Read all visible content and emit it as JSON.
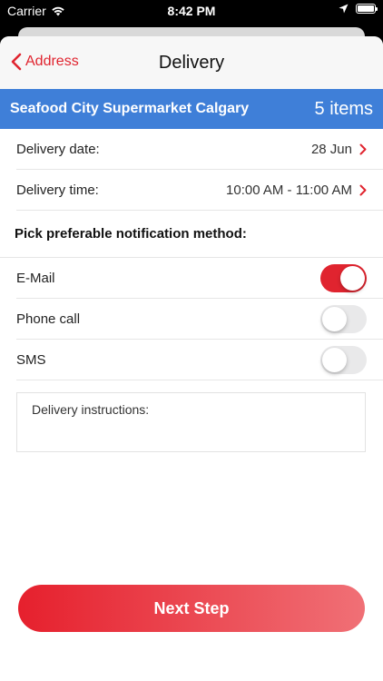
{
  "status_bar": {
    "carrier": "Carrier",
    "time": "8:42 PM"
  },
  "nav": {
    "back_label": "Address",
    "title": "Delivery"
  },
  "store": {
    "name": "Seafood City Supermarket Calgary",
    "count": "5 items"
  },
  "delivery": {
    "date_label": "Delivery date:",
    "date_value": "28 Jun",
    "time_label": "Delivery time:",
    "time_value": "10:00 AM - 11:00 AM"
  },
  "notifications": {
    "title": "Pick preferable notification method:",
    "options": [
      {
        "label": "E-Mail",
        "on": true
      },
      {
        "label": "Phone call",
        "on": false
      },
      {
        "label": "SMS",
        "on": false
      }
    ]
  },
  "instructions": {
    "placeholder": "Delivery instructions:"
  },
  "next_button": {
    "label": "Next Step"
  },
  "colors": {
    "accent": "#e0242f",
    "banner": "#3f7fd8"
  }
}
